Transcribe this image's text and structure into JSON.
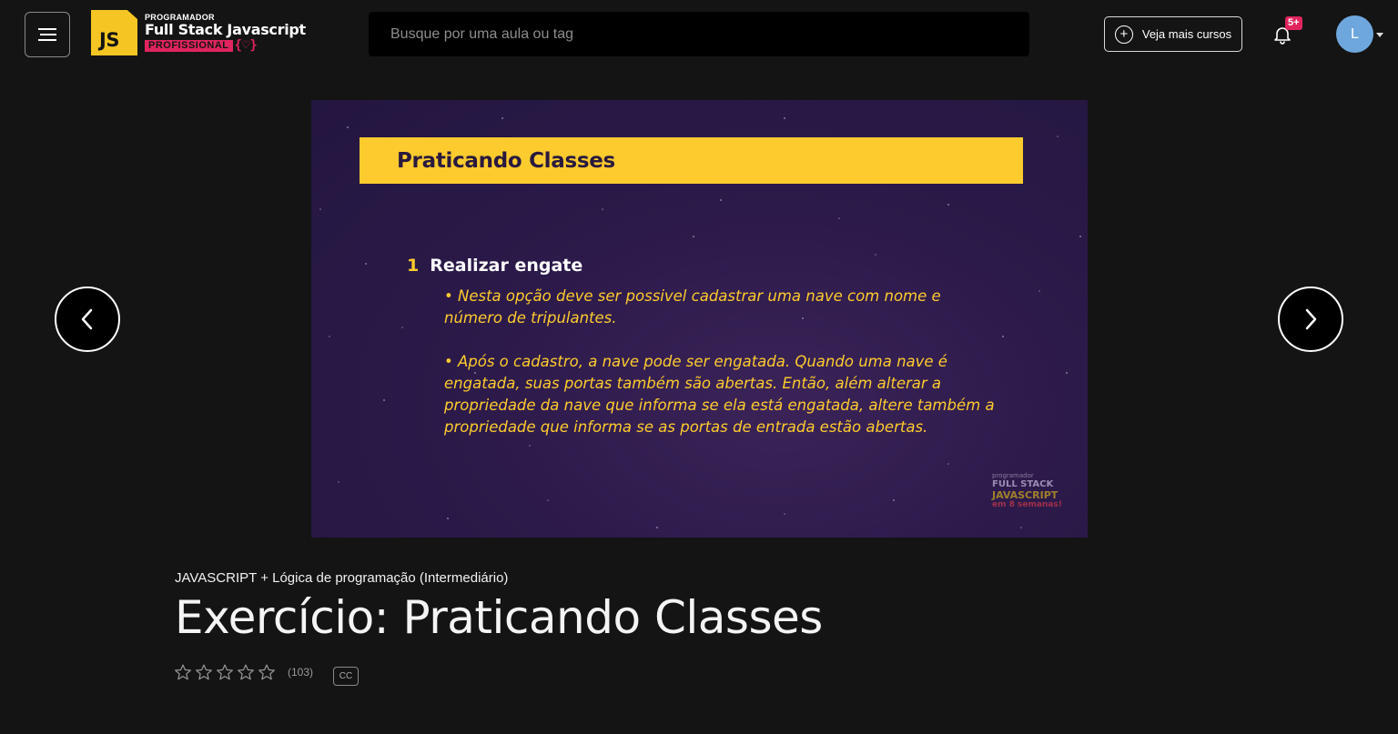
{
  "header": {
    "menu_icon": "hamburger-icon",
    "logo": {
      "badge_text": "JS",
      "kicker": "PROGRAMADOR",
      "title": "Full Stack Javascript",
      "tag": "PROFISSIONAL",
      "brace": "{♡}"
    },
    "search": {
      "placeholder": "Busque por uma aula ou tag",
      "value": ""
    },
    "more_courses": {
      "icon": "plus-circle-icon",
      "label": "Veja mais cursos"
    },
    "notifications": {
      "icon": "bell-icon",
      "badge": "5+"
    },
    "avatar": {
      "initial": "L",
      "color": "#6ea7dd"
    }
  },
  "slide": {
    "header": "Praticando Classes",
    "item_number": "1",
    "item_title": "Realizar engate",
    "bullets": [
      "• Nesta opção deve ser possivel cadastrar uma nave com nome e número de tripulantes.",
      "• Após o cadastro, a nave pode ser engatada. Quando uma nave é engatada, suas portas também são abertas. Então, além alterar a propriedade da nave que informa se ela está engatada, altere também a propriedade que informa se as portas de entrada estão abertas."
    ],
    "watermark": {
      "line0": "programador",
      "line1": "FULL STACK",
      "line2": "JAVASCRIPT",
      "line3": "em 8 semanas!"
    },
    "colors": {
      "accent": "#fdcb2e",
      "background": "#2c1a4a"
    }
  },
  "navigation": {
    "prev_icon": "chevron-left-icon",
    "next_icon": "chevron-right-icon"
  },
  "lesson": {
    "course_name": "JAVASCRIPT + Lógica de programação (Intermediário)",
    "title": "Exercício: Praticando Classes",
    "rating": {
      "stars": 0,
      "max_stars": 5,
      "count": "(103)"
    },
    "cc_label": "CC"
  }
}
